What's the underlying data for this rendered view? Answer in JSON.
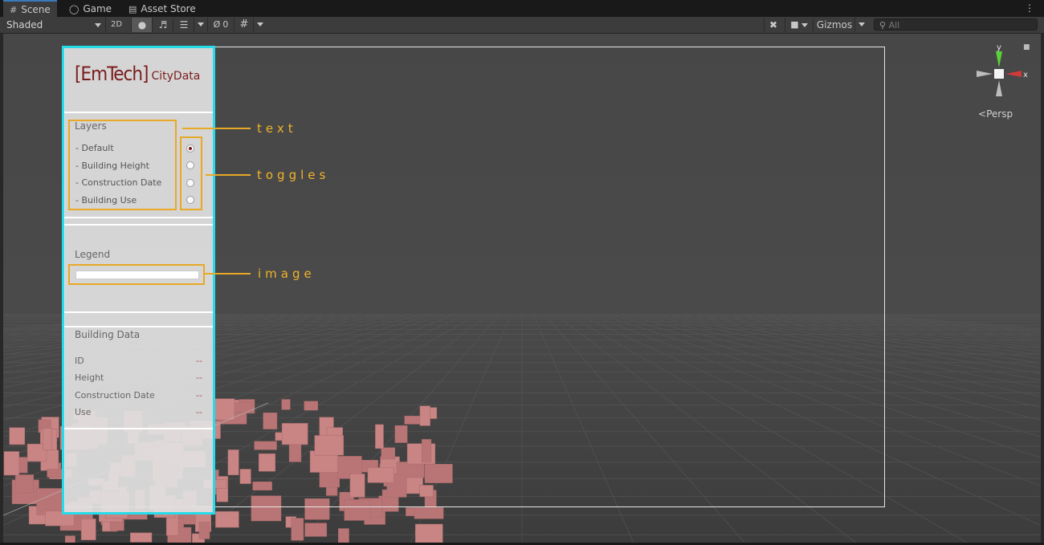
{
  "tabs": [
    {
      "label": "Scene",
      "icon": "grid-icon",
      "active": true
    },
    {
      "label": "Game",
      "icon": "gamepad-icon",
      "active": false
    },
    {
      "label": "Asset Store",
      "icon": "bag-icon",
      "active": false
    }
  ],
  "toolbar": {
    "shading_mode": "Shaded",
    "mode_2d": "2D",
    "hidden_count": "0",
    "gizmos_label": "Gizmos",
    "search_placeholder": "All"
  },
  "scene_gizmo": {
    "y_label": "y",
    "x_label": "x",
    "projection": "Persp"
  },
  "panel": {
    "title_bracket": "[EmTech]",
    "title_sub": "CityData",
    "layers_heading": "Layers",
    "layers": [
      {
        "label": "- Default",
        "selected": true
      },
      {
        "label": "- Building Height",
        "selected": false
      },
      {
        "label": "- Construction Date",
        "selected": false
      },
      {
        "label": "- Building Use",
        "selected": false
      }
    ],
    "legend_heading": "Legend",
    "building_heading": "Building Data",
    "building_rows": [
      {
        "label": "ID",
        "value": "--"
      },
      {
        "label": "Height",
        "value": "--"
      },
      {
        "label": "Construction Date",
        "value": "--"
      },
      {
        "label": "Use",
        "value": "--"
      }
    ]
  },
  "annotations": {
    "text": "text",
    "toggles": "toggles",
    "image": "image"
  },
  "colors": {
    "accent_cyan": "#27dcea",
    "annotation_orange": "#e9a826",
    "title_maroon": "#7a1d1d",
    "building_pink": "#c98484"
  }
}
